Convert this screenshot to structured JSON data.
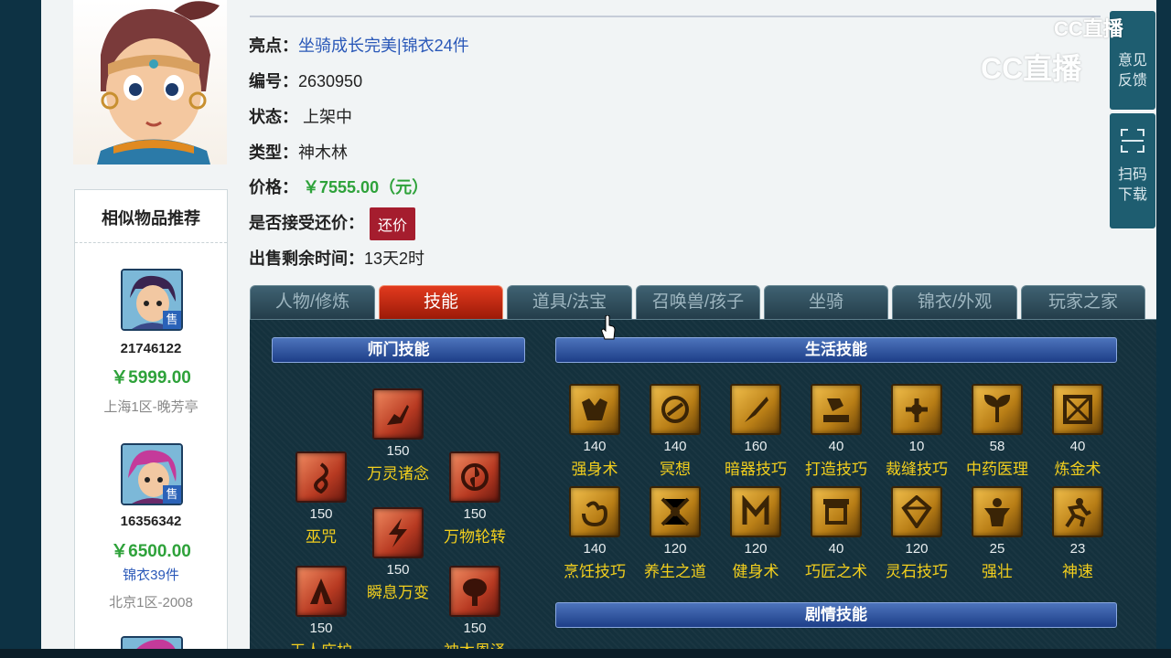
{
  "info": {
    "highlight_label": "亮点：",
    "highlight_link1": "坐骑成长完美",
    "highlight_sep": "|",
    "highlight_link2": "锦衣24件",
    "id_label": "编号：",
    "id_value": "2630950",
    "status_label": "状态：",
    "status_value": "上架中",
    "type_label": "类型：",
    "type_value": "神木林",
    "price_label": "价格：",
    "price_value": "￥7555.00（元）",
    "counter_label": "是否接受还价：",
    "counter_button": "还价",
    "remain_label": "出售剩余时间：",
    "remain_value": "13天2时"
  },
  "similar": {
    "title": "相似物品推荐",
    "sold_badge": "售",
    "items": [
      {
        "id": "21746122",
        "price": "￥5999.00",
        "server": "上海1区-晚芳亭"
      },
      {
        "id": "16356342",
        "price": "￥6500.00",
        "tag": "锦衣39件",
        "server": "北京1区-2008"
      }
    ]
  },
  "tabs": [
    "人物/修炼",
    "技能",
    "道具/法宝",
    "召唤兽/孩子",
    "坐骑",
    "锦衣/外观",
    "玩家之家"
  ],
  "active_tab": "技能",
  "sections": {
    "mentor": "师门技能",
    "life": "生活技能",
    "story": "剧情技能"
  },
  "mentor_skills": [
    {
      "level": "150",
      "name": "万灵诸念"
    },
    {
      "level": "150",
      "name": "巫咒"
    },
    {
      "level": "150",
      "name": "万物轮转"
    },
    {
      "level": "150",
      "name": "瞬息万变"
    },
    {
      "level": "150",
      "name": "天人庇护"
    },
    {
      "level": "150",
      "name": "神木恩泽"
    }
  ],
  "life_skills": [
    {
      "level": "140",
      "name": "强身术"
    },
    {
      "level": "140",
      "name": "冥想"
    },
    {
      "level": "160",
      "name": "暗器技巧"
    },
    {
      "level": "40",
      "name": "打造技巧"
    },
    {
      "level": "10",
      "name": "裁缝技巧"
    },
    {
      "level": "58",
      "name": "中药医理"
    },
    {
      "level": "40",
      "name": "炼金术"
    },
    {
      "level": "140",
      "name": "烹饪技巧"
    },
    {
      "level": "120",
      "name": "养生之道"
    },
    {
      "level": "120",
      "name": "健身术"
    },
    {
      "level": "40",
      "name": "巧匠之术"
    },
    {
      "level": "120",
      "name": "灵石技巧"
    },
    {
      "level": "25",
      "name": "强壮"
    },
    {
      "level": "23",
      "name": "神速"
    }
  ],
  "side": {
    "feedback_line1": "意见",
    "feedback_line2": "反馈",
    "scan_line1": "扫码",
    "scan_line2": "下载"
  },
  "watermark": {
    "small": "CC直播",
    "large": "CC直播"
  }
}
